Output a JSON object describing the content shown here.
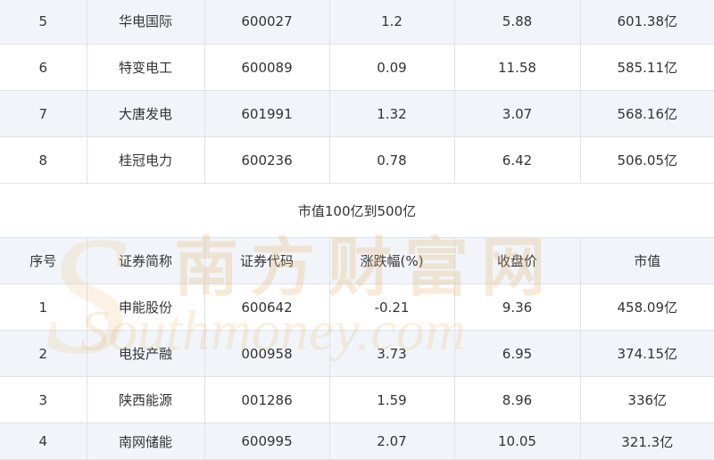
{
  "top_rows": [
    {
      "idx": "5",
      "name": "华电国际",
      "code": "600027",
      "change": "1.2",
      "close": "5.88",
      "cap": "601.38亿"
    },
    {
      "idx": "6",
      "name": "特变电工",
      "code": "600089",
      "change": "0.09",
      "close": "11.58",
      "cap": "585.11亿"
    },
    {
      "idx": "7",
      "name": "大唐发电",
      "code": "601991",
      "change": "1.32",
      "close": "3.07",
      "cap": "568.16亿"
    },
    {
      "idx": "8",
      "name": "桂冠电力",
      "code": "600236",
      "change": "0.78",
      "close": "6.42",
      "cap": "506.05亿"
    }
  ],
  "section_title": "市值100亿到500亿",
  "headers": [
    "序号",
    "证券简称",
    "证券代码",
    "涨跌幅(%)",
    "收盘价",
    "市值"
  ],
  "bottom_rows": [
    {
      "idx": "1",
      "name": "申能股份",
      "code": "600642",
      "change": "-0.21",
      "close": "9.36",
      "cap": "458.09亿"
    },
    {
      "idx": "2",
      "name": "电投产融",
      "code": "000958",
      "change": "3.73",
      "close": "6.95",
      "cap": "374.15亿"
    },
    {
      "idx": "3",
      "name": "陕西能源",
      "code": "001286",
      "change": "1.59",
      "close": "8.96",
      "cap": "336亿"
    },
    {
      "idx": "4",
      "name": "南网储能",
      "code": "600995",
      "change": "2.07",
      "close": "10.05",
      "cap": "321.3亿"
    }
  ],
  "watermark": {
    "cn": "南方财富网",
    "en": "Southmoney.com",
    "color": "#e7b56e"
  }
}
